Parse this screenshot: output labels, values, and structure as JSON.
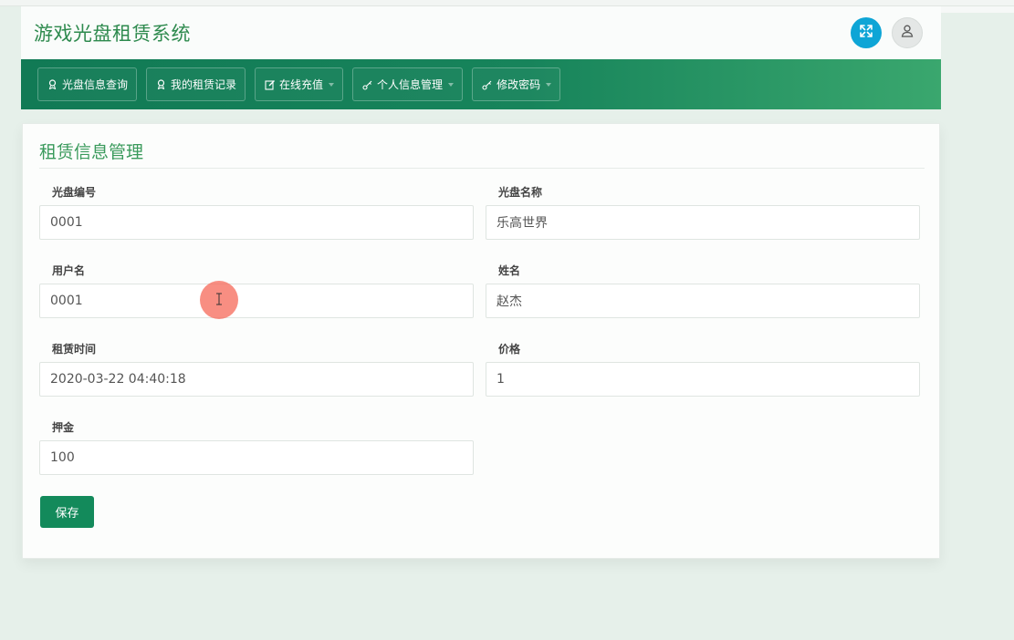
{
  "app": {
    "title": "游戏光盘租赁系统"
  },
  "header": {
    "fullscreen_icon": "expand-icon",
    "user_icon": "user-icon",
    "accent_color": "#0ea5d6"
  },
  "nav": {
    "items": [
      {
        "label": "光盘信息查询",
        "icon": "disc-icon",
        "dropdown": false
      },
      {
        "label": "我的租赁记录",
        "icon": "disc-icon",
        "dropdown": false
      },
      {
        "label": "在线充值",
        "icon": "edit-icon",
        "dropdown": true
      },
      {
        "label": "个人信息管理",
        "icon": "key-icon",
        "dropdown": true
      },
      {
        "label": "修改密码",
        "icon": "key-icon",
        "dropdown": true
      }
    ]
  },
  "form": {
    "title": "租赁信息管理",
    "fields": {
      "disc_id": {
        "label": "光盘编号",
        "value": "0001"
      },
      "disc_name": {
        "label": "光盘名称",
        "value": "乐高世界"
      },
      "username": {
        "label": "用户名",
        "value": "0001"
      },
      "name": {
        "label": "姓名",
        "value": "赵杰"
      },
      "rent_time": {
        "label": "租赁时间",
        "value": "2020-03-22 04:40:18"
      },
      "price": {
        "label": "价格",
        "value": "1"
      },
      "deposit": {
        "label": "押金",
        "value": "100"
      }
    },
    "save_label": "保存"
  },
  "colors": {
    "brand_green": "#2e8a4e",
    "nav_start": "#117a55",
    "nav_end": "#3aa76e",
    "save_button": "#138a5b"
  }
}
